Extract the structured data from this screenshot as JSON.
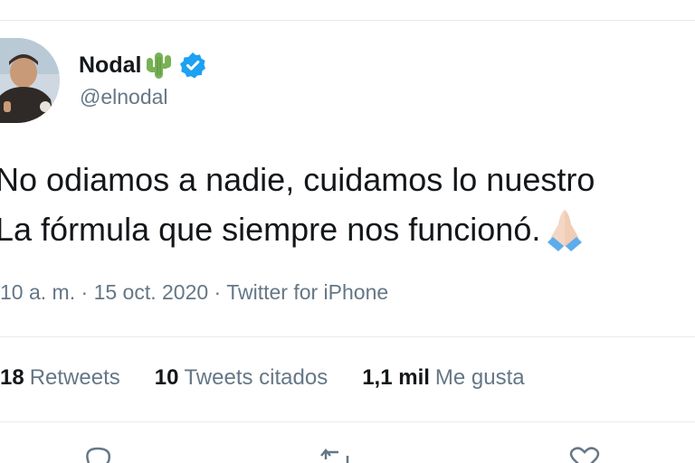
{
  "user": {
    "display_name": "Nodal",
    "handle": "@elnodal",
    "verified": true,
    "name_emoji": "cactus-icon"
  },
  "tweet": {
    "line1": "No odiamos a nadie, cuidamos lo nuestro",
    "line2": "La fórmula que siempre nos funcionó.",
    "trailing_emoji": "folded-hands-icon"
  },
  "meta": {
    "time": "10 a. m.",
    "separator1": " · ",
    "date": "15 oct. 2020",
    "separator2": " · ",
    "source": "Twitter for iPhone"
  },
  "stats": {
    "retweets_count": "18",
    "retweets_label": "Retweets",
    "quotes_count": "10",
    "quotes_label": "Tweets citados",
    "likes_count": "1,1 mil",
    "likes_label": "Me gusta"
  },
  "actions": [
    "reply-icon",
    "retweet-icon",
    "like-icon"
  ],
  "colors": {
    "text_primary": "#14171a",
    "text_secondary": "#657786",
    "verified_blue": "#1da1f2",
    "divider": "#e6ecf0"
  }
}
